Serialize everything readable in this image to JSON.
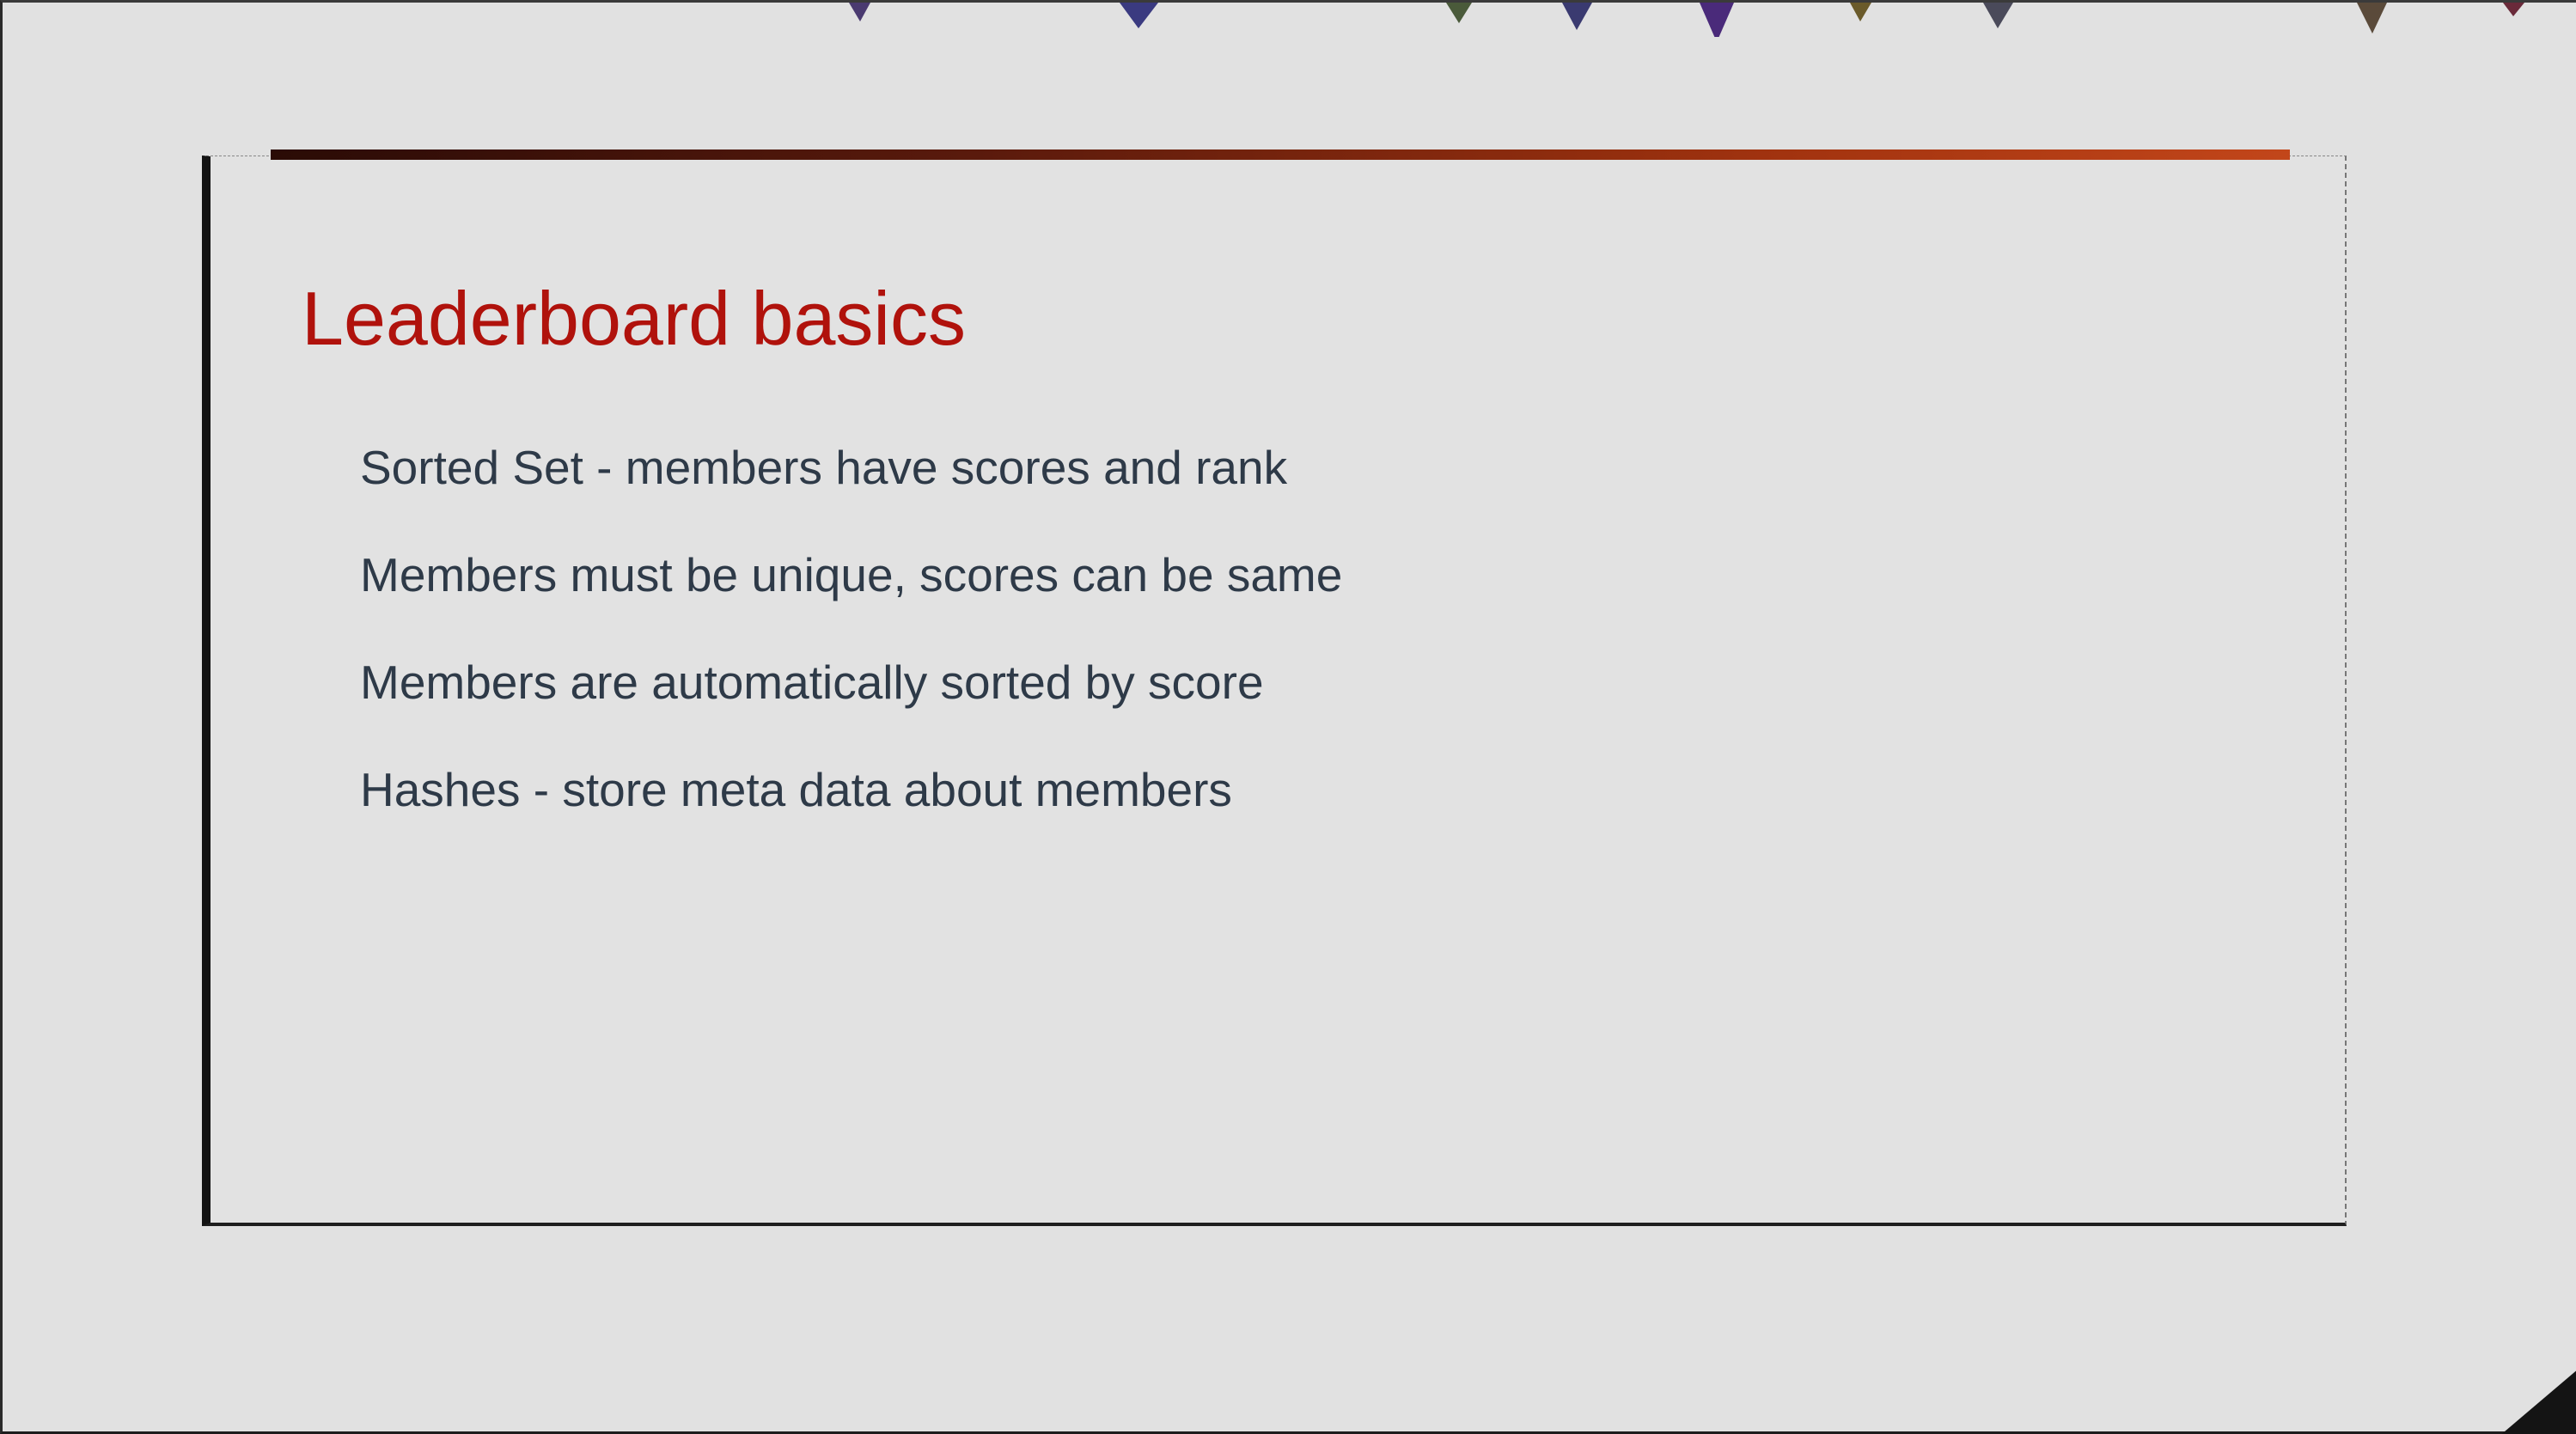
{
  "slide": {
    "title": "Leaderboard basics",
    "bullets": [
      "Sorted Set - members have scores and rank",
      "Members must be unique, scores can be same",
      "Members are automatically sorted by score",
      "Hashes - store meta data about members"
    ]
  },
  "colors": {
    "background": "#e1e1e1",
    "title": "#b0120c",
    "body_text": "#2e3a48",
    "accent_bar_start": "#2a0b06",
    "accent_bar_end": "#c2461a"
  }
}
